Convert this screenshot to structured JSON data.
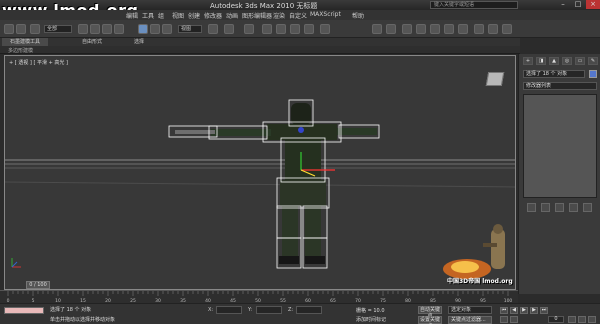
{
  "app": {
    "title": "Autodesk 3ds Max  2010   无标题",
    "search_placeholder": "键入关键字或短语",
    "watermark": "www.lmod.org"
  },
  "menu": [
    "编辑",
    "工具",
    "组",
    "视图",
    "创建",
    "修改器",
    "动画",
    "图形编辑器",
    "渲染",
    "自定义",
    "MAXScript",
    "帮助"
  ],
  "toolbar": {
    "selection_filter": "全部",
    "reference_coord": "视图"
  },
  "ribbon": {
    "tabs": [
      "石墨建模工具",
      "自由形式",
      "选择"
    ],
    "sub_label": "多边形建模"
  },
  "viewport": {
    "label": "+ [ 透视 ] [ 平滑 + 高光 ]"
  },
  "command_panel": {
    "tabs": [
      "+",
      "◨",
      "▲",
      "◎",
      "▭",
      "✎"
    ],
    "name_field": "选择了 18 个 对象",
    "modifier_list": "修改器列表"
  },
  "timeline": {
    "slider_label": "0 / 100",
    "ticks": [
      "0",
      "5",
      "10",
      "15",
      "20",
      "25",
      "30",
      "35",
      "40",
      "45",
      "50",
      "55",
      "60",
      "65",
      "70",
      "75",
      "80",
      "85",
      "90",
      "95",
      "100"
    ]
  },
  "status": {
    "selected": "选择了 18 个 对象",
    "prompt": "单击并拖动以选择并移动对象",
    "x_label": "X:",
    "y_label": "Y:",
    "z_label": "Z:",
    "grid": "栅格 = 10.0",
    "add_time_tag": "添加时间标记",
    "auto_key": "自动关键点",
    "set_key": "设置关键点",
    "selected_dropdown": "选定对象",
    "key_filters": "关键点过滤器...",
    "frame": "0"
  },
  "corner_text": "中国3D帝国 lmod.org",
  "colors": {
    "viewport_bg": "#383838",
    "ui_bg": "#3a3a3a",
    "selection_white": "#ffffff",
    "status_swatch": "#e9b9b9"
  }
}
